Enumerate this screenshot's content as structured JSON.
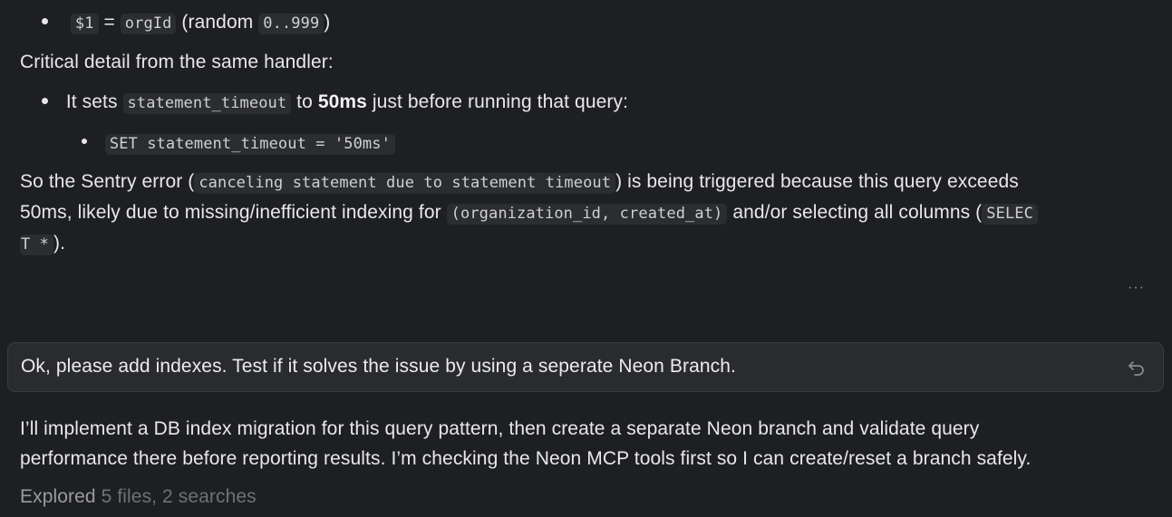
{
  "top_bullet": {
    "param": "$1",
    "equals": "=",
    "field": "orgId",
    "note_open": "(random",
    "range": "0..999",
    "note_close": ")"
  },
  "critical_label": "Critical detail from the same handler:",
  "sets_bullet": {
    "prefix": "It sets",
    "code": "statement_timeout",
    "middle": "to",
    "value": "50ms",
    "suffix": "just before running that query:"
  },
  "sub_bullet_code": "SET statement_timeout = '50ms'",
  "sentry_paragraph": {
    "p1": "So the Sentry error (",
    "code1": "canceling statement due to statement timeout",
    "p2": ") is being triggered because this query exceeds",
    "p3": "50ms, likely due to missing/inefficient indexing for",
    "code2": "(organization_id, created_at)",
    "p4": "and/or selecting all columns (",
    "code3a": "SELEC",
    "code3b": "T *",
    "p5": ")."
  },
  "more_icon": "···",
  "user_message": {
    "text": "Ok, please add indexes. Test if it solves the issue by using a seperate Neon Branch.",
    "icon": "undo-icon"
  },
  "assistant_reply": {
    "line1": "I’ll implement a DB index migration for this query pattern, then create a separate Neon branch and validate query",
    "line2": "performance there before reporting results. I’m checking the Neon MCP tools first so I can create/reset a branch safely."
  },
  "explored": {
    "label": "Explored",
    "detail": "5 files, 2 searches"
  },
  "colors": {
    "background": "#1e1f22",
    "text": "#e8e8ea",
    "code_bg": "#2c2d30",
    "muted": "#9a9ba0"
  }
}
